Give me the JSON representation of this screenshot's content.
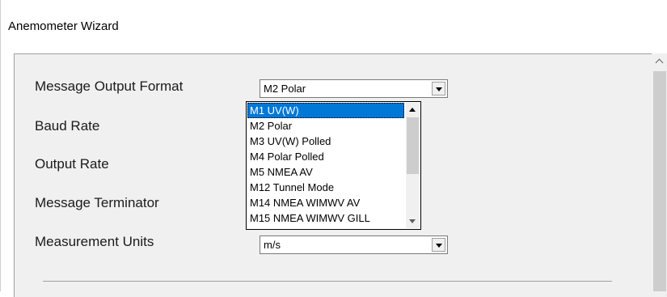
{
  "window": {
    "title": "Anemometer Wizard"
  },
  "form": {
    "labels": {
      "output_format": "Message Output Format",
      "baud_rate": "Baud Rate",
      "output_rate": "Output Rate",
      "terminator": "Message Terminator",
      "units": "Measurement Units"
    },
    "output_format_value": "M2 Polar",
    "units_value": "m/s"
  },
  "dropdown": {
    "items": [
      "M1 UV(W)",
      "M2 Polar",
      "M3 UV(W) Polled",
      "M4 Polar Polled",
      "M5 NMEA AV",
      "M12 Tunnel Mode",
      "M14 NMEA WIMWV AV",
      "M15 NMEA WIMWV GILL"
    ],
    "highlighted": "M1 UV(W)"
  },
  "icons": {
    "combo_arrow": "chevron-down-icon",
    "scroll_up": "chevron-up-icon",
    "scroll_down": "chevron-down-icon"
  },
  "colors": {
    "selection": "#0078d7",
    "panel": "#f0f0f0",
    "scrollbar_thumb": "#cdcdcd"
  }
}
